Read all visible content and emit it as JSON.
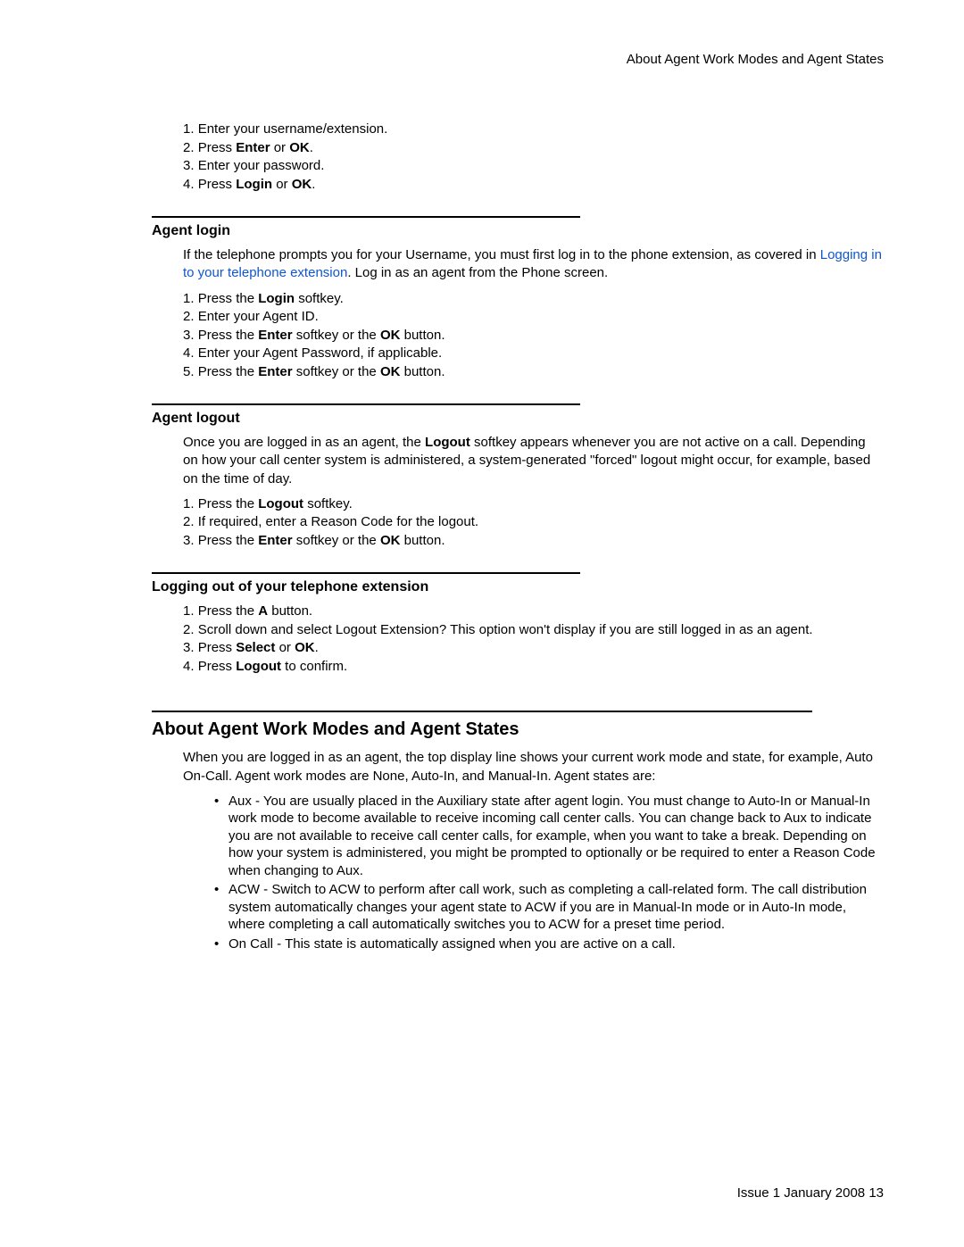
{
  "header": {
    "title": "About Agent Work Modes and Agent States"
  },
  "intro_list": {
    "i1a": "Enter your username/extension.",
    "i2a": "Press ",
    "i2b": "Enter",
    "i2c": " or ",
    "i2d": "OK",
    "i2e": ".",
    "i3a": "Enter your password.",
    "i4a": "Press ",
    "i4b": "Login",
    "i4c": " or ",
    "i4d": "OK",
    "i4e": "."
  },
  "agent_login": {
    "heading": "Agent login",
    "p1a": "If the telephone prompts you for your Username, you must first log in to the phone extension, as covered in ",
    "p1link": "Logging in to your telephone extension",
    "p1b": ". Log in as an agent from the Phone screen.",
    "l1a": "Press the ",
    "l1b": "Login",
    "l1c": " softkey.",
    "l2a": "Enter your Agent ID.",
    "l3a": "Press the ",
    "l3b": "Enter",
    "l3c": " softkey or the ",
    "l3d": "OK",
    "l3e": " button.",
    "l4a": "Enter your Agent Password, if applicable.",
    "l5a": "Press the ",
    "l5b": "Enter",
    "l5c": " softkey or the ",
    "l5d": "OK",
    "l5e": " button."
  },
  "agent_logout": {
    "heading": "Agent logout",
    "p1a": "Once you are logged in as an agent, the ",
    "p1b": "Logout",
    "p1c": " softkey appears whenever you are not active on a call. Depending on how your call center system is administered, a system-generated \"forced\" logout might occur, for example, based on the time of day.",
    "l1a": "Press the ",
    "l1b": "Logout",
    "l1c": " softkey.",
    "l2a": "If required, enter a Reason Code for the logout.",
    "l3a": "Press the ",
    "l3b": "Enter",
    "l3c": " softkey or the ",
    "l3d": "OK",
    "l3e": " button."
  },
  "logout_ext": {
    "heading": "Logging out of your telephone extension",
    "l1a": "Press the ",
    "l1b": "A",
    "l1c": " button.",
    "l2a": "Scroll down and select Logout Extension? This option won't display if you are still logged in as an agent.",
    "l3a": "Press ",
    "l3b": "Select",
    "l3c": " or ",
    "l3d": "OK",
    "l3e": ".",
    "l4a": "Press ",
    "l4b": "Logout",
    "l4c": " to confirm."
  },
  "work_modes": {
    "heading": "About Agent Work Modes and Agent States",
    "p1": "When you are logged in as an agent, the top display line shows your current work mode and state, for example, Auto On-Call. Agent work modes are None, Auto-In, and Manual-In. Agent states are:",
    "b1": "Aux - You are usually placed in the Auxiliary state after agent login. You must change to Auto-In or Manual-In work mode to become available to receive incoming call center calls. You can change back to Aux to indicate you are not available to receive call center calls, for example, when you want to take a break. Depending on how your system is administered, you might be prompted to optionally or be required to enter a Reason Code when changing to Aux.",
    "b2": "ACW - Switch to ACW to perform after call work, such as completing a call-related form. The call distribution system automatically changes your agent state to ACW if you are in Manual-In mode or in Auto-In mode, where completing a call automatically switches you to ACW for a preset time period.",
    "b3": "On Call - This state is automatically assigned when you are active on a call."
  },
  "footer": {
    "issue": "Issue 1 January 2008 ",
    "page": "13"
  }
}
